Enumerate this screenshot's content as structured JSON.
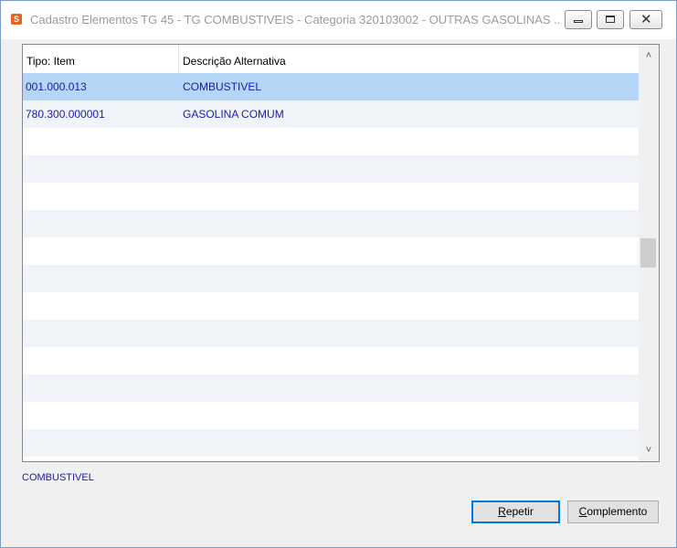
{
  "window": {
    "title": "Cadastro Elementos TG 45 - TG COMBUSTIVEIS - Categoria 320103002 - OUTRAS GASOLINAS ...",
    "app_icon_glyph": "S",
    "controls": {
      "minimize": "minimize-icon",
      "maximize": "maximize-icon",
      "close": "close-icon",
      "close_glyph": "✕"
    }
  },
  "grid": {
    "columns": [
      "Tipo: Item",
      "Descrição Alternativa"
    ],
    "rows": [
      {
        "item": "001.000.013",
        "descricao": "COMBUSTIVEL",
        "selected": true
      },
      {
        "item": "780.300.000001",
        "descricao": "GASOLINA COMUM",
        "selected": false
      }
    ],
    "scrollbar": {
      "up_glyph": "˄",
      "down_glyph": "˅"
    }
  },
  "status": {
    "text": "COMBUSTIVEL"
  },
  "buttons": {
    "repetir": {
      "mnemonic": "R",
      "rest": "epetir"
    },
    "complemento": {
      "mnemonic": "C",
      "rest": "omplemento"
    }
  },
  "colors": {
    "selected_row": "#b5d6f7",
    "alt_row": "#f0f4f9",
    "cell_text": "#1a1aa8",
    "app_icon": "#e8641c"
  }
}
